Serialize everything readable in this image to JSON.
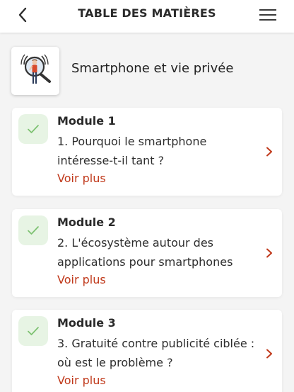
{
  "header": {
    "title": "TABLE DES MATIÈRES"
  },
  "course": {
    "title": "Smartphone et vie privée"
  },
  "modules": [
    {
      "name": "Module 1",
      "description": "1. Pourquoi le smartphone intéresse-t-il tant ?",
      "link": "Voir plus",
      "completed": true
    },
    {
      "name": "Module 2",
      "description": "2. L'écosystème autour des applications pour smartphones",
      "link": "Voir plus",
      "completed": true
    },
    {
      "name": "Module 3",
      "description": "3. Gratuité contre publicité ciblée : où est le problème ?",
      "link": "Voir plus",
      "completed": true
    }
  ],
  "colors": {
    "accent": "#c0391b",
    "check_bg": "#e7f4e4",
    "check": "#7cc170"
  },
  "icons": {
    "back": "chevron-left-icon",
    "menu": "hamburger-menu-icon",
    "check": "checkmark-icon",
    "chevron": "chevron-right-icon"
  }
}
